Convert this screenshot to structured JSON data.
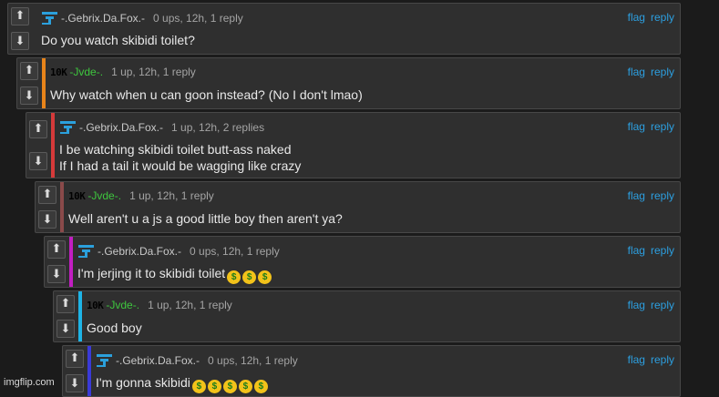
{
  "actions": {
    "flag": "flag",
    "reply": "reply"
  },
  "icons": {
    "upvote": "up-arrow-icon",
    "downvote": "down-arrow-icon",
    "emoji": "money-mouth-face-emoji"
  },
  "colors": {
    "link": "#2c9fe0",
    "jvde_name": "#3ec63e",
    "fox_name": "#c9c9c9"
  },
  "comments": [
    {
      "user": "-.Gebrix.Da.Fox.-",
      "avatar": "fox",
      "meta": "0 ups, 12h, 1 reply",
      "lines": [
        "Do you watch skibidi toilet?"
      ],
      "emoji_count": 0,
      "accent": ""
    },
    {
      "user": "-Jvde-.",
      "avatar": "10k",
      "avatar_text": "10K",
      "meta": "1 up, 12h, 1 reply",
      "lines": [
        "Why watch when u can goon instead? (No I don't lmao)"
      ],
      "emoji_count": 0,
      "accent": "#e8841a"
    },
    {
      "user": "-.Gebrix.Da.Fox.-",
      "avatar": "fox",
      "meta": "1 up, 12h, 2 replies",
      "lines": [
        "I be watching skibidi toilet butt-ass naked",
        "If I had a tail it would be wagging like crazy"
      ],
      "emoji_count": 0,
      "accent": "#d63a3a"
    },
    {
      "user": "-Jvde-.",
      "avatar": "10k",
      "avatar_text": "10K",
      "meta": "1 up, 12h, 1 reply",
      "lines": [
        "Well aren't u a js a good little boy then aren't ya?"
      ],
      "emoji_count": 0,
      "accent": "#8a4a4a"
    },
    {
      "user": "-.Gebrix.Da.Fox.-",
      "avatar": "fox",
      "meta": "0 ups, 12h, 1 reply",
      "lines": [
        "I'm jerjing it to skibidi toilet"
      ],
      "emoji_count": 3,
      "accent": "#c21ec2"
    },
    {
      "user": "-Jvde-.",
      "avatar": "10k",
      "avatar_text": "10K",
      "meta": "1 up, 12h, 1 reply",
      "lines": [
        "Good boy"
      ],
      "emoji_count": 0,
      "accent": "#1eb4e6"
    },
    {
      "user": "-.Gebrix.Da.Fox.-",
      "avatar": "fox",
      "meta": "0 ups, 12h, 1 reply",
      "lines": [
        "I'm gonna skibidi"
      ],
      "emoji_count": 5,
      "accent": "#3a3ad8"
    }
  ],
  "watermark": "imgflip.com"
}
